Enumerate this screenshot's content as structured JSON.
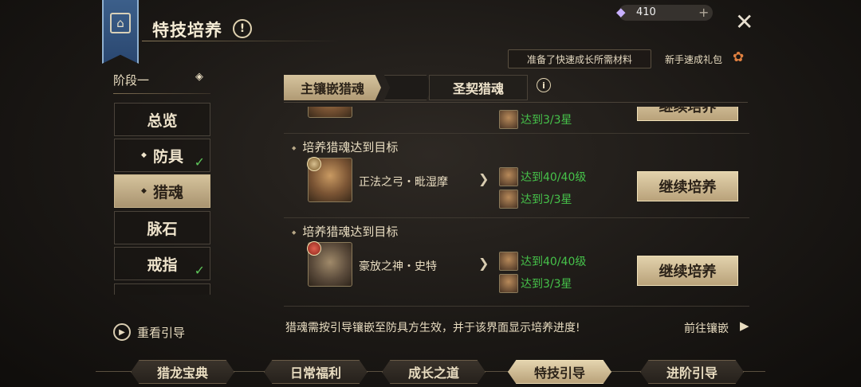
{
  "header": {
    "title": "特技培养",
    "currency": {
      "icon": "diamond-icon",
      "amount": "410",
      "plus": "+"
    },
    "close": "✕",
    "notice": "准备了快速成长所需材料",
    "gift_link": "新手速成礼包"
  },
  "sidebar": {
    "stage": "阶段一",
    "items": [
      {
        "label": "总览",
        "active": false,
        "done": false
      },
      {
        "label": "防具",
        "active": false,
        "done": true
      },
      {
        "label": "猎魂",
        "active": true,
        "done": false
      },
      {
        "label": "脉石",
        "active": false,
        "done": false
      },
      {
        "label": "戒指",
        "active": false,
        "done": true
      }
    ],
    "replay": "重看引导"
  },
  "tabs": [
    {
      "label": "主镶嵌猎魂",
      "active": true
    },
    {
      "label": "圣契猎魂",
      "active": false
    }
  ],
  "rows": [
    {
      "title": "培养猎魂达到目标",
      "name": "正法之弓・毗湿摩",
      "req_level": "达到40/40级",
      "req_star": "达到3/3星",
      "button": "继续培养"
    },
    {
      "title": "培养猎魂达到目标",
      "name": "豪放之神・史特",
      "req_level": "达到40/40级",
      "req_star": "达到3/3星",
      "button": "继续培养"
    }
  ],
  "partial_row": {
    "req_star": "达到3/3星",
    "button": "继续培养"
  },
  "footer": {
    "note": "猎魂需按引导镶嵌至防具方生效，并于该界面显示培养进度!",
    "goto": "前往镶嵌"
  },
  "bottom_tabs": [
    {
      "label": "猎龙宝典",
      "active": false
    },
    {
      "label": "日常福利",
      "active": false
    },
    {
      "label": "成长之道",
      "active": false
    },
    {
      "label": "特技引导",
      "active": true
    },
    {
      "label": "进阶引导",
      "active": false
    }
  ],
  "colors": {
    "accent": "#c9b489",
    "complete": "#46c24a",
    "gem": "#c8b0ff"
  }
}
